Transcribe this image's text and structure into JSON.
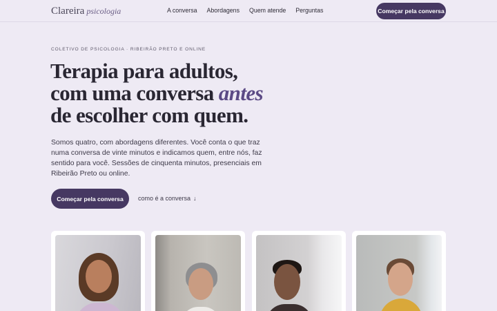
{
  "nav": {
    "brand": "Clareira",
    "brand_sub": "psicologia",
    "links": [
      "A conversa",
      "Abordagens",
      "Quem atende",
      "Perguntas"
    ],
    "cta": "Começar pela conversa"
  },
  "hero": {
    "eyebrow": "COLETIVO DE PSICOLOGIA · RIBEIRÃO PRETO E ONLINE",
    "headline_1": "Terapia para adultos,",
    "headline_2a": "com uma conversa ",
    "headline_2b": "antes",
    "headline_3": "de escolher com quem.",
    "lede": "Somos quatro, com abordagens diferentes. Você conta o que traz numa conversa de vinte minutos e indicamos quem, entre nós, faz sentido para você. Sessões de cinquenta minutos, presenciais em Ribeirão Preto ou online.",
    "cta_primary": "Começar pela conversa",
    "cta_secondary": "como é a conversa",
    "arrow": "↓"
  },
  "therapists": [
    {
      "photo": "portrait-woman-curly-hair"
    },
    {
      "photo": "portrait-woman-gray-hair"
    },
    {
      "photo": "portrait-man-beard"
    },
    {
      "photo": "portrait-woman-glasses"
    }
  ],
  "colors": {
    "background": "#EEEAF4",
    "accent": "#463862",
    "accent_italic": "#5B4A85"
  }
}
